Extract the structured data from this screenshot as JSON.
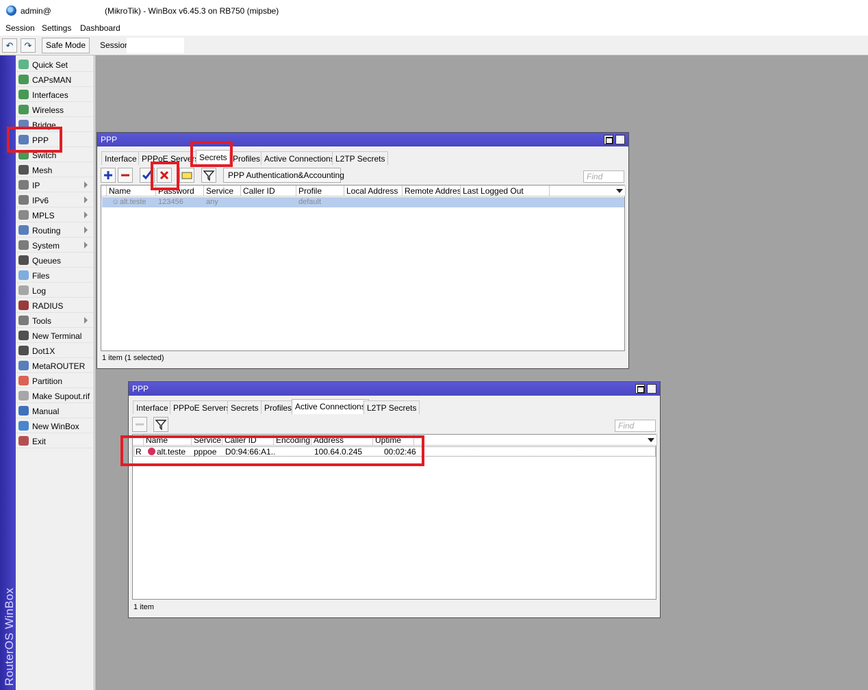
{
  "window": {
    "user": "admin@",
    "title": "(MikroTik) - WinBox v6.45.3 on RB750 (mipsbe)"
  },
  "menu": [
    "Session",
    "Settings",
    "Dashboard"
  ],
  "toolbar": {
    "safe_mode": "Safe Mode",
    "session_label": "Session:"
  },
  "brand": "RouterOS WinBox",
  "sidebar": {
    "items": [
      {
        "label": "Quick Set",
        "icon": "quick-set-icon"
      },
      {
        "label": "CAPsMAN",
        "icon": "capsman-icon"
      },
      {
        "label": "Interfaces",
        "icon": "interfaces-icon"
      },
      {
        "label": "Wireless",
        "icon": "wireless-icon"
      },
      {
        "label": "Bridge",
        "icon": "bridge-icon"
      },
      {
        "label": "PPP",
        "icon": "ppp-icon"
      },
      {
        "label": "Switch",
        "icon": "switch-icon"
      },
      {
        "label": "Mesh",
        "icon": "mesh-icon"
      },
      {
        "label": "IP",
        "icon": "ip-icon",
        "submenu": true
      },
      {
        "label": "IPv6",
        "icon": "ipv6-icon",
        "submenu": true
      },
      {
        "label": "MPLS",
        "icon": "mpls-icon",
        "submenu": true
      },
      {
        "label": "Routing",
        "icon": "routing-icon",
        "submenu": true
      },
      {
        "label": "System",
        "icon": "system-icon",
        "submenu": true
      },
      {
        "label": "Queues",
        "icon": "queues-icon"
      },
      {
        "label": "Files",
        "icon": "files-icon"
      },
      {
        "label": "Log",
        "icon": "log-icon"
      },
      {
        "label": "RADIUS",
        "icon": "radius-icon"
      },
      {
        "label": "Tools",
        "icon": "tools-icon",
        "submenu": true
      },
      {
        "label": "New Terminal",
        "icon": "terminal-icon"
      },
      {
        "label": "Dot1X",
        "icon": "dot1x-icon"
      },
      {
        "label": "MetaROUTER",
        "icon": "metarouter-icon"
      },
      {
        "label": "Partition",
        "icon": "partition-icon"
      },
      {
        "label": "Make Supout.rif",
        "icon": "supout-icon"
      },
      {
        "label": "Manual",
        "icon": "manual-icon"
      },
      {
        "label": "New WinBox",
        "icon": "winbox-icon"
      },
      {
        "label": "Exit",
        "icon": "exit-icon"
      }
    ]
  },
  "ppp1": {
    "title": "PPP",
    "tabs": [
      "Interface",
      "PPPoE Servers",
      "Secrets",
      "Profiles",
      "Active Connections",
      "L2TP Secrets"
    ],
    "active_tab": "Secrets",
    "auth_button": "PPP Authentication&Accounting",
    "find_placeholder": "Find",
    "columns": [
      "Name",
      "Password",
      "Service",
      "Caller ID",
      "Profile",
      "Local Address",
      "Remote Address",
      "Last Logged Out"
    ],
    "rows": [
      {
        "name": "alt.teste",
        "password": "123456",
        "service": "any",
        "caller_id": "",
        "profile": "default",
        "local": "",
        "remote": "",
        "last": ""
      }
    ],
    "status": "1 item (1 selected)"
  },
  "ppp2": {
    "title": "PPP",
    "tabs": [
      "Interface",
      "PPPoE Servers",
      "Secrets",
      "Profiles",
      "Active Connections",
      "L2TP Secrets"
    ],
    "active_tab": "Active Connections",
    "find_placeholder": "Find",
    "columns": [
      "Name",
      "Service",
      "Caller ID",
      "Encoding",
      "Address",
      "Uptime"
    ],
    "rows": [
      {
        "flag": "R",
        "name": "alt.teste",
        "service": "pppoe",
        "caller_id": "D0:94:66:A1...",
        "encoding": "",
        "address": "100.64.0.245",
        "uptime": "00:02:46"
      }
    ],
    "status": "1 item"
  }
}
